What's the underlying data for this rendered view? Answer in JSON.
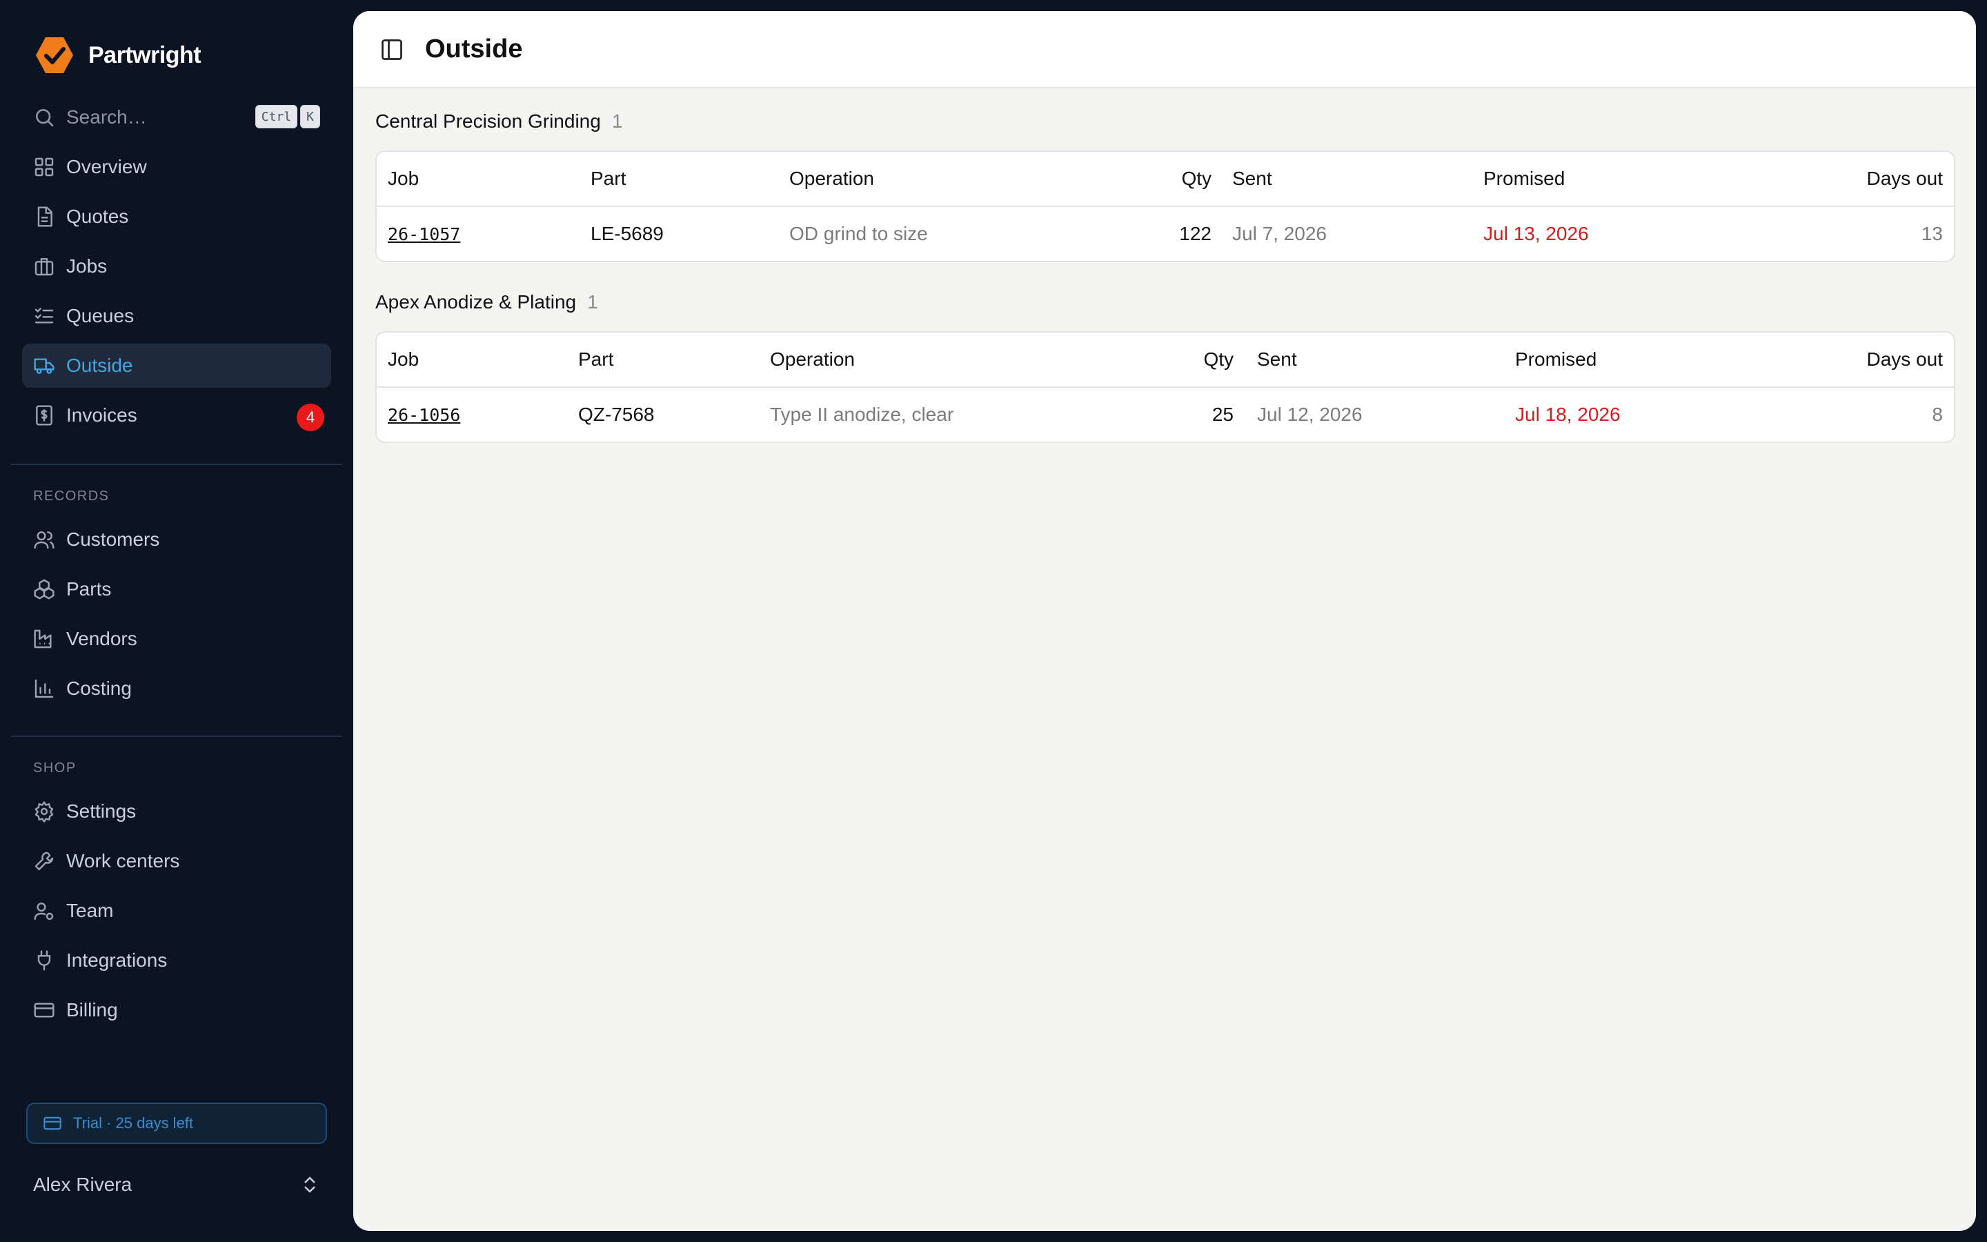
{
  "app": {
    "name": "Partwright"
  },
  "search": {
    "placeholder": "Search…",
    "kbd": [
      "Ctrl",
      "K"
    ]
  },
  "nav": {
    "main": [
      {
        "label": "Overview",
        "icon": "grid-icon"
      },
      {
        "label": "Quotes",
        "icon": "file-icon"
      },
      {
        "label": "Jobs",
        "icon": "briefcase-icon"
      },
      {
        "label": "Queues",
        "icon": "list-check-icon"
      },
      {
        "label": "Outside",
        "icon": "truck-icon",
        "active": true
      },
      {
        "label": "Invoices",
        "icon": "receipt-icon",
        "badge": "4"
      }
    ],
    "records_label": "RECORDS",
    "records": [
      {
        "label": "Customers",
        "icon": "users-icon"
      },
      {
        "label": "Parts",
        "icon": "boxes-icon"
      },
      {
        "label": "Vendors",
        "icon": "factory-icon"
      },
      {
        "label": "Costing",
        "icon": "bar-chart-icon"
      }
    ],
    "shop_label": "SHOP",
    "shop": [
      {
        "label": "Settings",
        "icon": "gear-icon"
      },
      {
        "label": "Work centers",
        "icon": "wrench-icon"
      },
      {
        "label": "Team",
        "icon": "user-cog-icon"
      },
      {
        "label": "Integrations",
        "icon": "plug-icon"
      },
      {
        "label": "Billing",
        "icon": "credit-card-icon"
      }
    ]
  },
  "trial": {
    "text": "Trial · 25 days left"
  },
  "user": {
    "name": "Alex Rivera"
  },
  "page": {
    "title": "Outside"
  },
  "groups": [
    {
      "vendor": "Central Precision Grinding",
      "count": "1",
      "columns": [
        "Job",
        "Part",
        "Operation",
        "Qty",
        "Sent",
        "Promised",
        "Days out"
      ],
      "rows": [
        {
          "job": "26-1057",
          "part": "LE-5689",
          "operation": "OD grind to size",
          "qty": "122",
          "sent": "Jul 7, 2026",
          "promised": "Jul 13, 2026",
          "days_out": "13"
        }
      ]
    },
    {
      "vendor": "Apex Anodize & Plating",
      "count": "1",
      "columns": [
        "Job",
        "Part",
        "Operation",
        "Qty",
        "Sent",
        "Promised",
        "Days out"
      ],
      "rows": [
        {
          "job": "26-1056",
          "part": "QZ-7568",
          "operation": "Type II anodize, clear",
          "qty": "25",
          "sent": "Jul 12, 2026",
          "promised": "Jul 18, 2026",
          "days_out": "8"
        }
      ]
    }
  ],
  "colors": {
    "accent": "#3ea6e6",
    "overdue": "#d81b1b",
    "brand": "#f07c1a",
    "badge": "#ea1a1a"
  }
}
